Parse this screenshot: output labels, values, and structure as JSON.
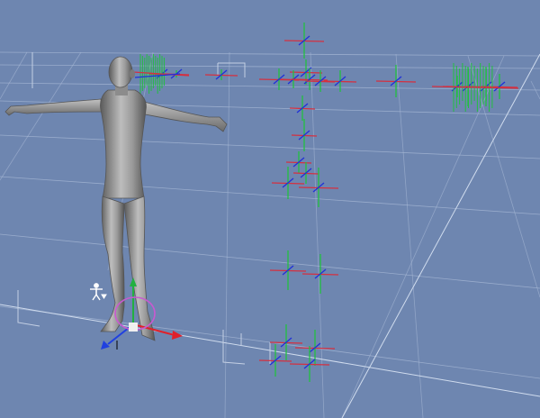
{
  "viewport": {
    "background": "#6e86b0",
    "grid_color": "#a8b9d6",
    "bracket_color": "#c4d0e4"
  },
  "figure": {
    "icon": "human-figure-t-pose",
    "body_color": "#8a8a8a",
    "highlight_color": "#c8c8c8",
    "shadow_color": "#4a4a4a"
  },
  "gizmo": {
    "icon": "transform-gizmo-icon",
    "x_axis_color": "#e0202a",
    "y_axis_color": "#22b040",
    "z_axis_color": "#2040e0",
    "ring_color": "#c85ad0",
    "center_color": "#f0f0f0"
  },
  "skeleton_markers": {
    "icon": "joint-crosshair-icon",
    "horizontal_color": "#d43040",
    "vertical_color": "#22c040",
    "diagonal_color": "#2030d8"
  },
  "figure_manipulator": {
    "icon": "figure-manipulator-icon",
    "color": "#ffffff"
  }
}
